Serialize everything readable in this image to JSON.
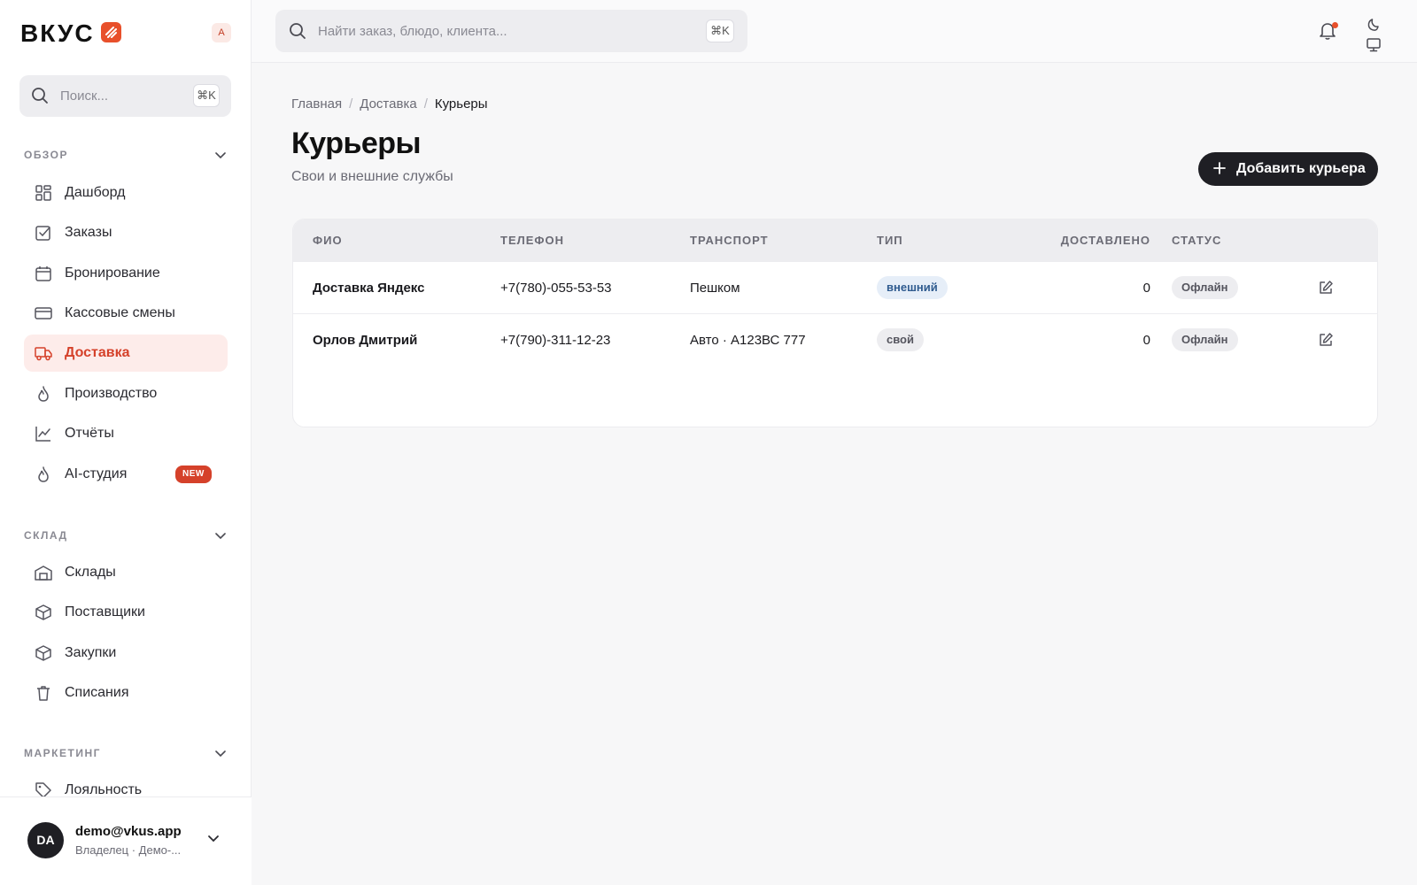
{
  "app": {
    "logo_text": "ВКУС",
    "workspace_badge": "A"
  },
  "sidebar": {
    "search": {
      "placeholder": "Поиск...",
      "shortcut": "⌘K"
    },
    "sections": [
      {
        "title": "ОБЗОР",
        "items": [
          {
            "label": "Дашборд",
            "icon": "dashboard-icon"
          },
          {
            "label": "Заказы",
            "icon": "orders-icon"
          },
          {
            "label": "Бронирование",
            "icon": "calendar-icon"
          },
          {
            "label": "Кассовые смены",
            "icon": "card-icon"
          },
          {
            "label": "Доставка",
            "icon": "truck-icon",
            "active": true
          },
          {
            "label": "Производство",
            "icon": "flame-icon"
          },
          {
            "label": "Отчёты",
            "icon": "chart-icon"
          },
          {
            "label": "AI-студия",
            "icon": "flame-icon",
            "badge": "NEW"
          }
        ]
      },
      {
        "title": "СКЛАД",
        "items": [
          {
            "label": "Склады",
            "icon": "warehouse-icon"
          },
          {
            "label": "Поставщики",
            "icon": "box-icon"
          },
          {
            "label": "Закупки",
            "icon": "box-icon"
          },
          {
            "label": "Списания",
            "icon": "trash-icon"
          }
        ]
      },
      {
        "title": "МАРКЕТИНГ",
        "items": [
          {
            "label": "Лояльность",
            "icon": "tag-icon"
          }
        ]
      }
    ],
    "user": {
      "initials": "DA",
      "email": "demo@vkus.app",
      "role": "Владелец · Демо-..."
    }
  },
  "topbar": {
    "search": {
      "placeholder": "Найти заказ, блюдо, клиента...",
      "shortcut": "⌘K"
    }
  },
  "main": {
    "breadcrumb": [
      "Главная",
      "Доставка",
      "Курьеры"
    ],
    "title": "Курьеры",
    "subtitle": "Свои и внешние службы",
    "add_button": "Добавить курьера",
    "table": {
      "headers": [
        "ФИО",
        "ТЕЛЕФОН",
        "ТРАНСПОРТ",
        "ТИП",
        "ДОСТАВЛЕНО",
        "СТАТУС"
      ],
      "rows": [
        {
          "name": "Доставка Яндекс",
          "phone": "+7(780)-055-53-53",
          "transport": "Пешком",
          "type": "внешний",
          "delivered": "0",
          "status": "Офлайн"
        },
        {
          "name": "Орлов Дмитрий",
          "phone": "+7(790)-311-12-23",
          "transport": "Авто · А123ВС 777",
          "type": "свой",
          "delivered": "0",
          "status": "Офлайн"
        }
      ]
    }
  },
  "colors": {
    "accent": "#d5412a",
    "active_bg": "#fdecea",
    "dark_button": "#1f1f24"
  }
}
